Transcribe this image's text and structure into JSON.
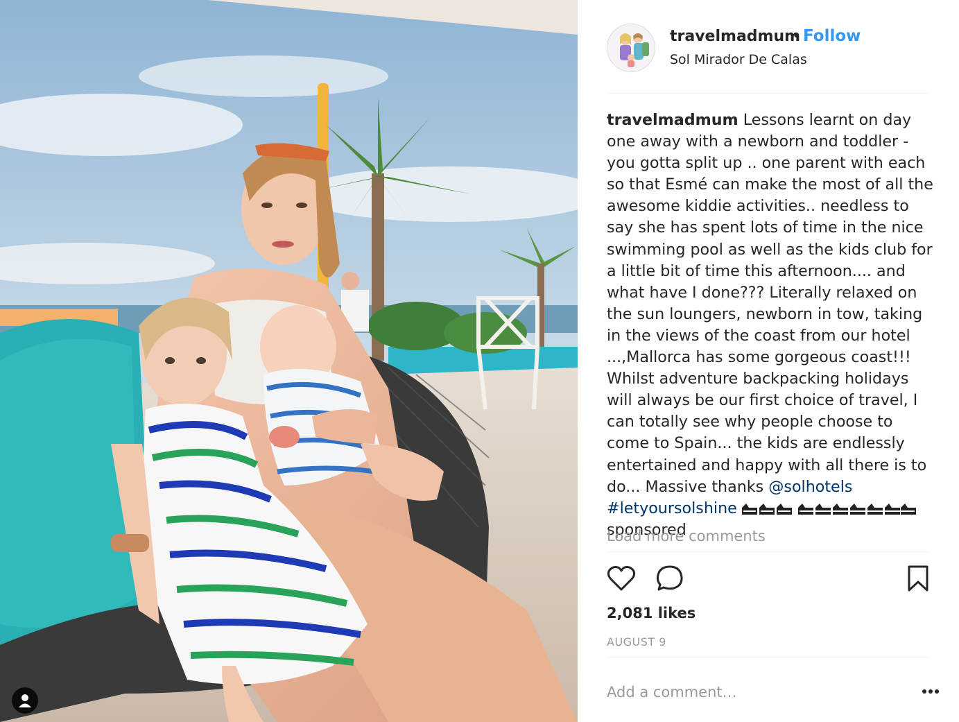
{
  "post": {
    "author": "travelmadmum",
    "follow_label": "Follow",
    "separator": "•",
    "location": "Sol Mirador De Calas",
    "caption": {
      "username": "travelmadmum",
      "text": "Lessons learnt on day one away with a newborn and toddler - you gotta split up .. one parent with each so that Esmé can make the most of all the awesome kiddie activities.. needless to say she has spent lots of time in the nice swimming pool as well as the kids club for a little bit of time this afternoon.... and what have I done??? Literally relaxed on the sun loungers, newborn in tow, taking in the views of the coast from our hotel ...,Mallorca has some gorgeous coast!!! Whilst adventure backpacking holidays will always be our first choice of travel, I can totally see why people choose to come to Spain... the kids are endlessly entertained and happy with all there is to do... Massive thanks",
      "mention": "@solhotels",
      "hashtag": "#letyoursolshine",
      "suffix": "sponsored"
    },
    "load_more_label": "Load more comments",
    "likes": "2,081 likes",
    "date": "AUGUST 9",
    "comment_placeholder": "Add a comment…"
  },
  "icons": {
    "like": "heart-icon",
    "comment": "comment-bubble-icon",
    "save": "bookmark-icon",
    "more": "more-options-icon",
    "user_tag": "user-tag-icon"
  },
  "colors": {
    "link": "#003569",
    "follow": "#3897f0",
    "muted": "#999999"
  }
}
